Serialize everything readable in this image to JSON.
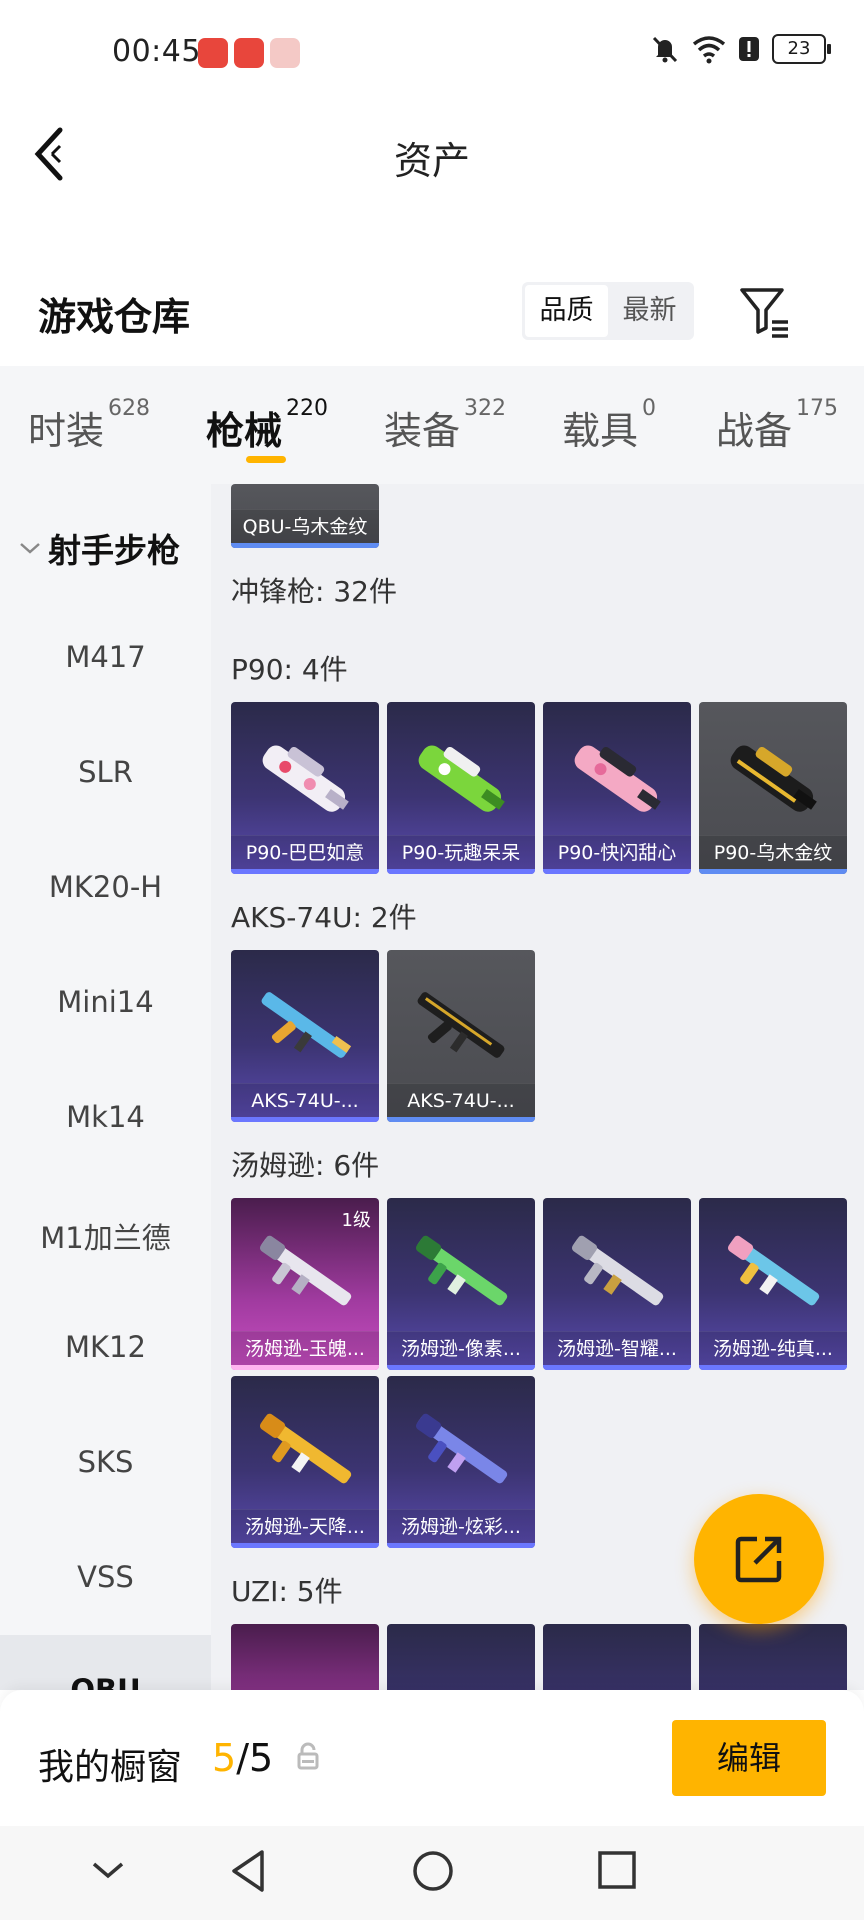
{
  "status": {
    "time": "00:45",
    "battery": "23"
  },
  "header": {
    "title": "资产"
  },
  "warehouse": {
    "title": "游戏仓库",
    "sort": [
      {
        "label": "品质",
        "active": true
      },
      {
        "label": "最新",
        "active": false
      }
    ]
  },
  "tabs": [
    {
      "label": "时装",
      "count": "628"
    },
    {
      "label": "枪械",
      "count": "220"
    },
    {
      "label": "装备",
      "count": "322"
    },
    {
      "label": "载具",
      "count": "0"
    },
    {
      "label": "战备",
      "count": "175"
    }
  ],
  "sidebar": {
    "group": "射手步枪",
    "items": [
      "M417",
      "SLR",
      "MK20-H",
      "Mini14",
      "Mk14",
      "M1加兰德",
      "MK12",
      "SKS",
      "VSS"
    ],
    "selected": "QBU"
  },
  "main": {
    "partial_card": "QBU-乌木金纹",
    "category": "冲锋枪: 32件",
    "groups": [
      {
        "label": "P90: 4件",
        "cards": [
          "P90-巴巴如意",
          "P90-玩趣呆呆",
          "P90-快闪甜心",
          "P90-乌木金纹"
        ]
      },
      {
        "label": "AKS-74U: 2件",
        "cards": [
          "AKS-74U-...",
          "AKS-74U-..."
        ]
      },
      {
        "label": "汤姆逊: 6件",
        "level": "1级",
        "cards": [
          "汤姆逊-玉魄...",
          "汤姆逊-像素...",
          "汤姆逊-智耀...",
          "汤姆逊-纯真...",
          "汤姆逊-天降...",
          "汤姆逊-炫彩..."
        ]
      },
      {
        "label": "UZI: 5件"
      }
    ]
  },
  "bottom": {
    "label": "我的橱窗",
    "count_current": "5",
    "count_total": "/5",
    "edit": "编辑"
  },
  "colors": {
    "accent": "#ffb400",
    "card_purple": "#3c3472",
    "card_gray": "#4e4f54"
  }
}
